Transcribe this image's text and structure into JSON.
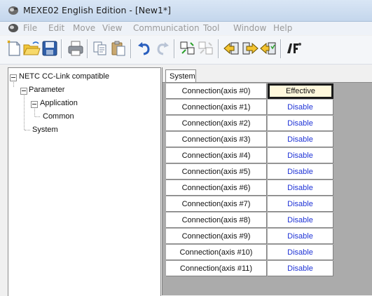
{
  "window": {
    "title": "MEXE02 English Edition - [New1*]"
  },
  "menu": [
    "File",
    "Edit",
    "Move",
    "View",
    "Communication",
    "Tool",
    "Window",
    "Help"
  ],
  "toolbar": {
    "buttons": [
      "new-file-icon",
      "open-folder-icon",
      "save-icon",
      "print-icon",
      "copy-icon",
      "paste-icon",
      "undo-icon",
      "redo-icon",
      "compare-icon",
      "compare-disabled-icon",
      "download-icon",
      "upload-icon",
      "verify-icon",
      "teaching-icon"
    ]
  },
  "tree": {
    "root": "NETC CC-Link compatible",
    "parameter": "Parameter",
    "application": "Application",
    "common": "Common",
    "system": "System"
  },
  "tabs": {
    "system": "System"
  },
  "table": {
    "rows": [
      {
        "label": "Connection(axis #0)",
        "value": "Effective"
      },
      {
        "label": "Connection(axis #1)",
        "value": "Disable"
      },
      {
        "label": "Connection(axis #2)",
        "value": "Disable"
      },
      {
        "label": "Connection(axis #3)",
        "value": "Disable"
      },
      {
        "label": "Connection(axis #4)",
        "value": "Disable"
      },
      {
        "label": "Connection(axis #5)",
        "value": "Disable"
      },
      {
        "label": "Connection(axis #6)",
        "value": "Disable"
      },
      {
        "label": "Connection(axis #7)",
        "value": "Disable"
      },
      {
        "label": "Connection(axis #8)",
        "value": "Disable"
      },
      {
        "label": "Connection(axis #9)",
        "value": "Disable"
      },
      {
        "label": "Connection(axis #10)",
        "value": "Disable"
      },
      {
        "label": "Connection(axis #11)",
        "value": "Disable"
      }
    ]
  },
  "colors": {
    "value_text": "#1f33d6",
    "selected_bg": "#fff8dc",
    "grid_bg": "#ababab"
  }
}
